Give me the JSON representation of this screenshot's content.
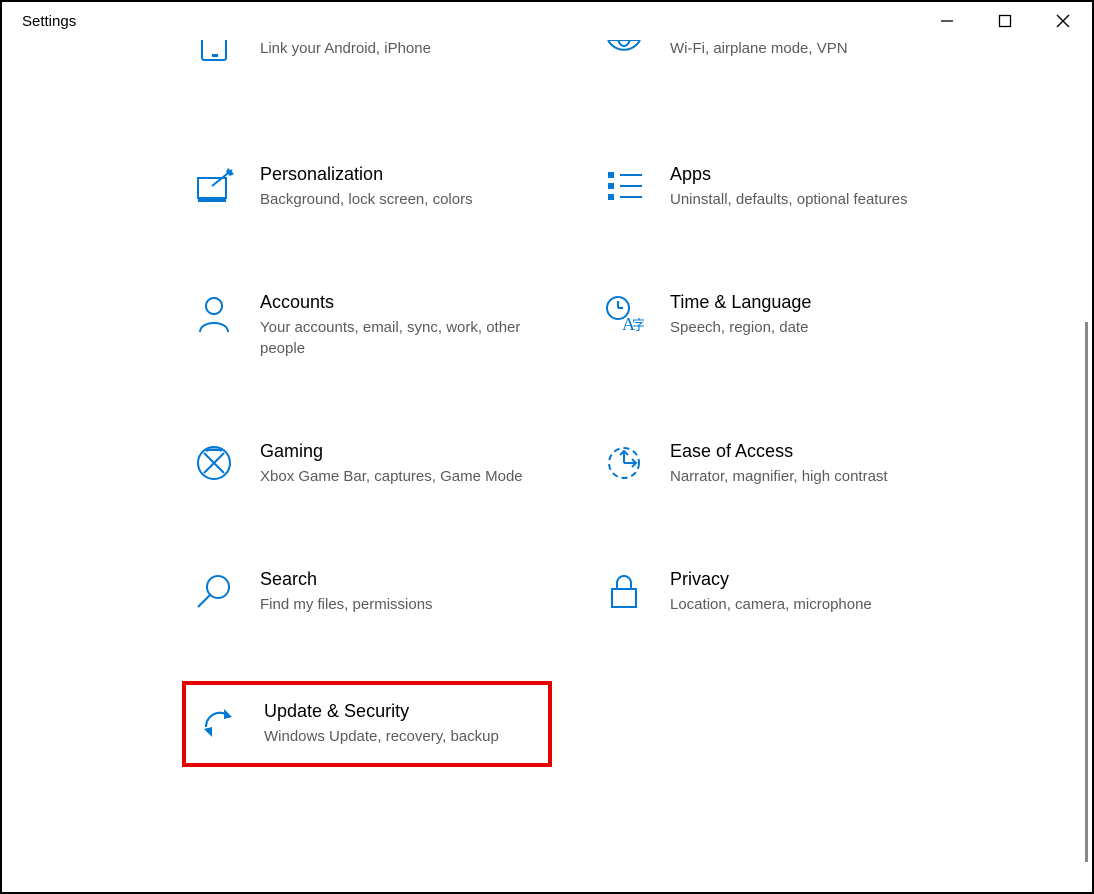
{
  "window": {
    "title": "Settings"
  },
  "partial": {
    "phone": {
      "desc": "Link your Android, iPhone"
    },
    "network": {
      "desc": "Wi-Fi, airplane mode, VPN"
    }
  },
  "categories": {
    "personalization": {
      "title": "Personalization",
      "desc": "Background, lock screen, colors"
    },
    "apps": {
      "title": "Apps",
      "desc": "Uninstall, defaults, optional features"
    },
    "accounts": {
      "title": "Accounts",
      "desc": "Your accounts, email, sync, work, other people"
    },
    "time": {
      "title": "Time & Language",
      "desc": "Speech, region, date"
    },
    "gaming": {
      "title": "Gaming",
      "desc": "Xbox Game Bar, captures, Game Mode"
    },
    "ease": {
      "title": "Ease of Access",
      "desc": "Narrator, magnifier, high contrast"
    },
    "search": {
      "title": "Search",
      "desc": "Find my files, permissions"
    },
    "privacy": {
      "title": "Privacy",
      "desc": "Location, camera, microphone"
    },
    "update": {
      "title": "Update & Security",
      "desc": "Windows Update, recovery, backup"
    }
  }
}
